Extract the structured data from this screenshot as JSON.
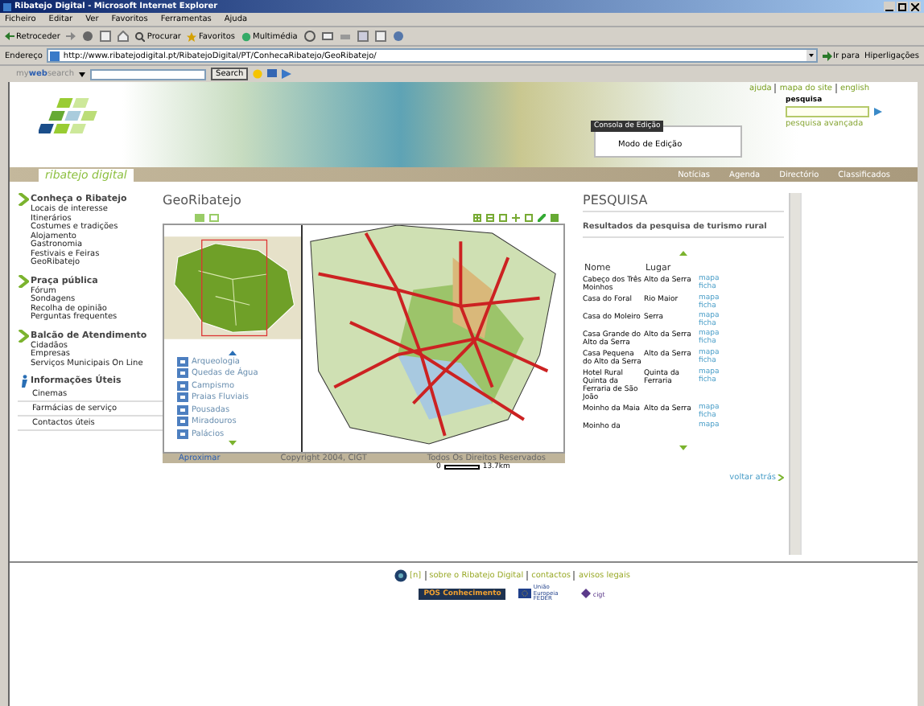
{
  "window": {
    "title": "Ribatejo Digital - Microsoft Internet Explorer"
  },
  "menu": [
    "Ficheiro",
    "Editar",
    "Ver",
    "Favoritos",
    "Ferramentas",
    "Ajuda"
  ],
  "toolbar": {
    "back": "Retroceder",
    "search": "Procurar",
    "favorites": "Favoritos",
    "media": "Multimédia"
  },
  "address": {
    "label": "Endereço",
    "url": "http://www.ribatejodigital.pt/RibatejoDigital/PT/ConhecaRibatejo/GeoRibatejo/",
    "go": "Ir para",
    "links": "Hiperligações"
  },
  "websearch": {
    "brand_a": "my",
    "brand_b": "web",
    "brand_c": "search",
    "button": "Search"
  },
  "header": {
    "logo": "ribatejo digital",
    "top_links": [
      "ajuda",
      "mapa do site",
      "english"
    ],
    "search_label": "pesquisa",
    "advanced": "pesquisa avançada",
    "console": {
      "title": "Consola de Edição",
      "item": "Modo de Edição"
    },
    "tabs": [
      "Notícias",
      "Agenda",
      "Directório",
      "Classificados"
    ]
  },
  "sidebar": [
    {
      "title": "Conheça o Ribatejo",
      "kind": "arrow",
      "items": [
        "Locais de interesse",
        "Itinerários",
        "Costumes e tradições",
        "Alojamento",
        "Gastronomia",
        "Festivais e Feiras",
        "GeoRibatejo"
      ]
    },
    {
      "title": "Praça pública",
      "kind": "arrow",
      "items": [
        "Fórum",
        "Sondagens",
        "Recolha de opinião",
        "Perguntas frequentes"
      ]
    },
    {
      "title": "Balcão de Atendimento",
      "kind": "arrow",
      "items": [
        "Cidadãos",
        "Empresas",
        "Serviços Municipais On Line"
      ]
    },
    {
      "title": "Informações Úteis",
      "kind": "info",
      "items": [
        "Cinemas",
        "Farmácias de serviço",
        "Contactos úteis"
      ]
    }
  ],
  "geo": {
    "title": "GeoRibatejo",
    "legend": [
      "Arqueologia",
      "Quedas de Água",
      "Campismo",
      "Praias Fluviais",
      "Pousadas",
      "Miradouros",
      "Palácios"
    ],
    "zoom_link": "Aproximar",
    "copyright": "Copyright 2004, CIGT",
    "rights": "Todos Os Direitos Reservados",
    "scale_start": "0",
    "scale_end": "13.7km"
  },
  "results": {
    "title": "PESQUISA",
    "subtitle": "Resultados da pesquisa de turismo rural",
    "columns": [
      "Nome",
      "Lugar"
    ],
    "rows": [
      {
        "name": "Cabeço dos Três Moinhos",
        "place": "Alto da Serra",
        "links": [
          "mapa",
          "ficha"
        ]
      },
      {
        "name": "Casa do Foral",
        "place": "Rio Maior",
        "links": [
          "mapa",
          "ficha"
        ]
      },
      {
        "name": "Casa do Moleiro",
        "place": "Serra",
        "links": [
          "mapa",
          "ficha"
        ]
      },
      {
        "name": "Casa Grande do Alto da Serra",
        "place": "Alto da Serra",
        "links": [
          "mapa",
          "ficha"
        ]
      },
      {
        "name": "Casa Pequena do Alto da Serra",
        "place": "Alto da Serra",
        "links": [
          "mapa",
          "ficha"
        ]
      },
      {
        "name": "Hotel Rural Quinta da Ferraria de São João",
        "place": "Quinta da Ferraria",
        "links": [
          "mapa",
          "ficha"
        ]
      },
      {
        "name": "Moinho da Maia",
        "place": "Alto da Serra",
        "links": [
          "mapa",
          "ficha"
        ]
      },
      {
        "name": "Moinho da",
        "place": "",
        "links": [
          "mapa"
        ]
      }
    ],
    "back": "voltar atrás"
  },
  "footer": {
    "marker": "[n]",
    "links": [
      "sobre o Ribatejo Digital",
      "contactos",
      "avisos legais"
    ],
    "logo_text": "POS Conhecimento",
    "eu_text": "União Europeia FEDER",
    "cigt": "cigt"
  }
}
